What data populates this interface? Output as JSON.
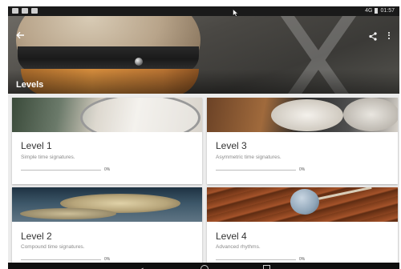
{
  "status_bar": {
    "time": "01:57",
    "signal_text": "4G"
  },
  "header": {
    "title": "Levels"
  },
  "colors": {
    "accent": "#4caf50",
    "status_bar": "#1a1a1a",
    "nav_bar": "#0f0f0f"
  },
  "icons": {
    "back": "arrow-back-icon",
    "share": "share-icon",
    "more": "more-vert-icon",
    "nav_back": "nav-back-triangle-icon",
    "nav_home": "nav-home-circle-icon",
    "nav_recent": "nav-recent-square-icon"
  },
  "levels": [
    {
      "title": "Level 1",
      "subtitle": "Simple time signatures.",
      "progress_percent": 0,
      "progress_label": "0%"
    },
    {
      "title": "Level 3",
      "subtitle": "Asymmetric time signatures.",
      "progress_percent": 0,
      "progress_label": "0%"
    },
    {
      "title": "Level 2",
      "subtitle": "Compound time signatures.",
      "progress_percent": 0,
      "progress_label": "0%"
    },
    {
      "title": "Level 4",
      "subtitle": "Advanced rhythms.",
      "progress_percent": 0,
      "progress_label": "0%"
    }
  ]
}
